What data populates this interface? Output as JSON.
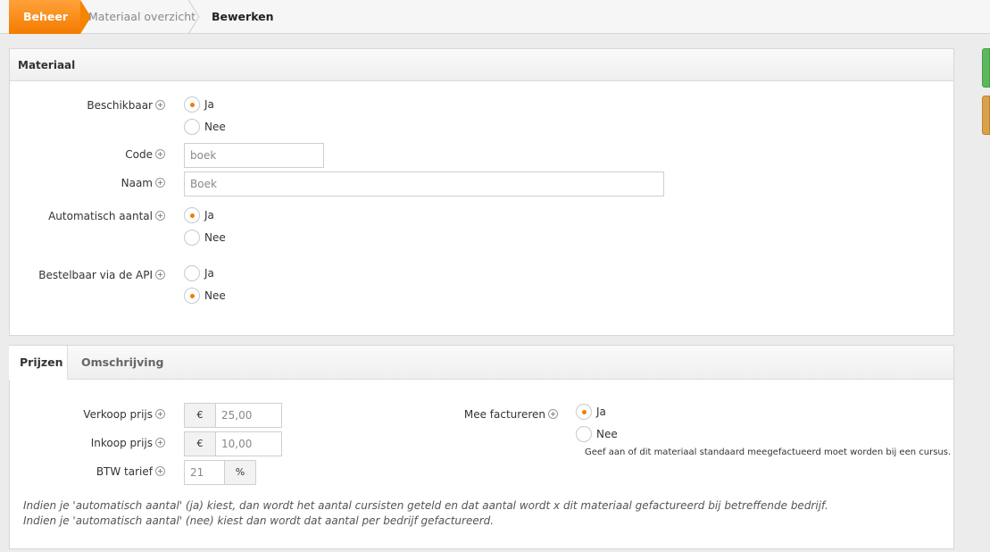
{
  "breadcrumb": {
    "home": "Beheer",
    "level2": "Materiaal overzicht",
    "level3": "Bewerken"
  },
  "materiaal_panel": {
    "title": "Materiaal",
    "beschikbaar": {
      "label": "Beschikbaar",
      "options": [
        "Ja",
        "Nee"
      ],
      "selected": "Ja"
    },
    "code": {
      "label": "Code",
      "value": "boek"
    },
    "naam": {
      "label": "Naam",
      "value": "Boek"
    },
    "automatisch_aantal": {
      "label": "Automatisch aantal",
      "options": [
        "Ja",
        "Nee"
      ],
      "selected": "Ja"
    },
    "bestelbaar_api": {
      "label": "Bestelbaar via de API",
      "options": [
        "Ja",
        "Nee"
      ],
      "selected": "Nee"
    }
  },
  "prijzen_panel": {
    "tabs": [
      "Prijzen",
      "Omschrijving"
    ],
    "active_tab": "Prijzen",
    "verkoop_prijs": {
      "label": "Verkoop prijs",
      "currency": "€",
      "value": "25,00"
    },
    "inkoop_prijs": {
      "label": "Inkoop prijs",
      "currency": "€",
      "value": "10,00"
    },
    "btw_tarief": {
      "label": "BTW tarief",
      "value": "21",
      "unit": "%"
    },
    "mee_factureren": {
      "label": "Mee factureren",
      "options": [
        "Ja",
        "Nee"
      ],
      "selected": "Ja",
      "help": "Geef aan of dit materiaal standaard meegefactueerd moet worden bij een cursus."
    },
    "note_line1": "Indien je 'automatisch aantal' (ja) kiest, dan wordt het aantal cursisten geteld en dat aantal wordt x dit materiaal gefactureerd bij betreffende bedrijf.",
    "note_line2": "Indien je 'automatisch aantal' (nee) kiest dan wordt dat aantal per bedrijf gefactureerd."
  },
  "colors": {
    "accent": "#f47c00",
    "side_green": "#5cb85c",
    "side_gold": "#d9a14a"
  }
}
